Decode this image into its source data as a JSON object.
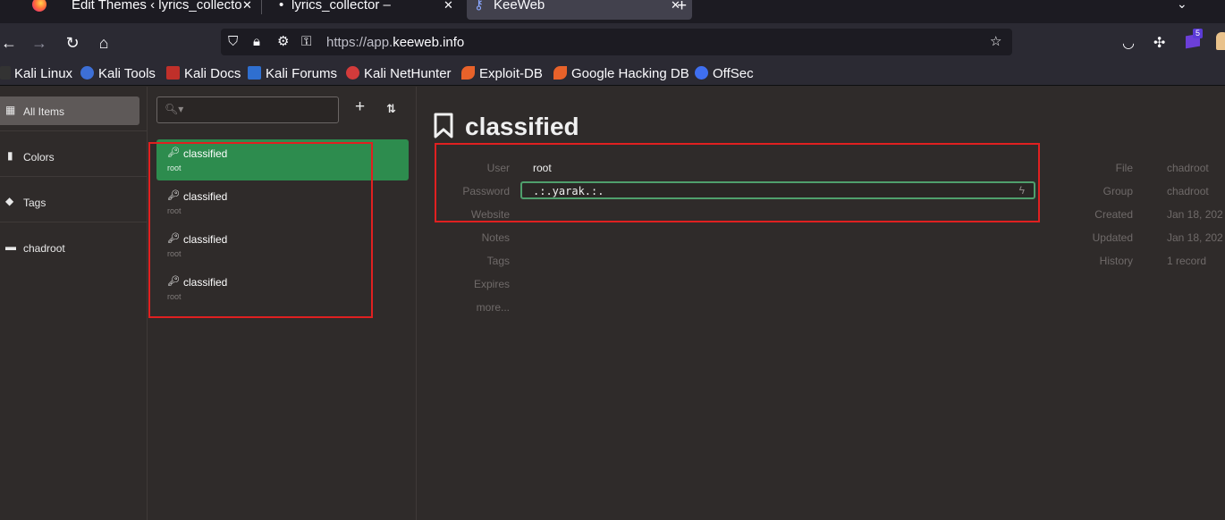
{
  "browser": {
    "tabs": [
      {
        "title": "Edit Themes ‹ lyrics_collecto",
        "close": "✕"
      },
      {
        "title": "lyrics_collector –",
        "close": "✕"
      },
      {
        "title": "KeeWeb",
        "close": "✕"
      }
    ],
    "new_tab": "+",
    "tabs_list": "⌄",
    "url_prefix": "https://app.",
    "url_domain": "keeweb.info",
    "extension_badge": "5",
    "bookmarks": [
      "Kali Linux",
      "Kali Tools",
      "Kali Docs",
      "Kali Forums",
      "Kali NetHunter",
      "Exploit-DB",
      "Google Hacking DB",
      "OffSec"
    ]
  },
  "menu": {
    "items": [
      {
        "label": "All Items",
        "icon": "grid-icon"
      },
      {
        "label": "Colors",
        "icon": "bookmark-icon"
      },
      {
        "label": "Tags",
        "icon": "tags-icon"
      },
      {
        "label": "chadroot",
        "icon": "folder-icon"
      }
    ]
  },
  "list": {
    "search_placeholder": "",
    "add_label": "+",
    "sort_label": "⇅",
    "entries": [
      {
        "title": "classified",
        "user": "root"
      },
      {
        "title": "classified",
        "user": "root"
      },
      {
        "title": "classified",
        "user": "root"
      },
      {
        "title": "classified",
        "user": "root"
      }
    ]
  },
  "details": {
    "title": "classified",
    "fields": {
      "user_label": "User",
      "user_value": "root",
      "password_label": "Password",
      "password_value": ".:.yarak.:.",
      "website_label": "Website",
      "notes_label": "Notes",
      "tags_label": "Tags",
      "expires_label": "Expires",
      "more_label": "more..."
    },
    "meta": {
      "file_label": "File",
      "file_value": "chadroot",
      "group_label": "Group",
      "group_value": "chadroot",
      "created_label": "Created",
      "created_value": "Jan 18, 202",
      "updated_label": "Updated",
      "updated_value": "Jan 18, 202",
      "history_label": "History",
      "history_value": "1 record"
    }
  },
  "colors": {
    "selected_entry": "#2d8c4e",
    "password_border": "#4f9f6c",
    "annotation_red": "#e02020"
  }
}
